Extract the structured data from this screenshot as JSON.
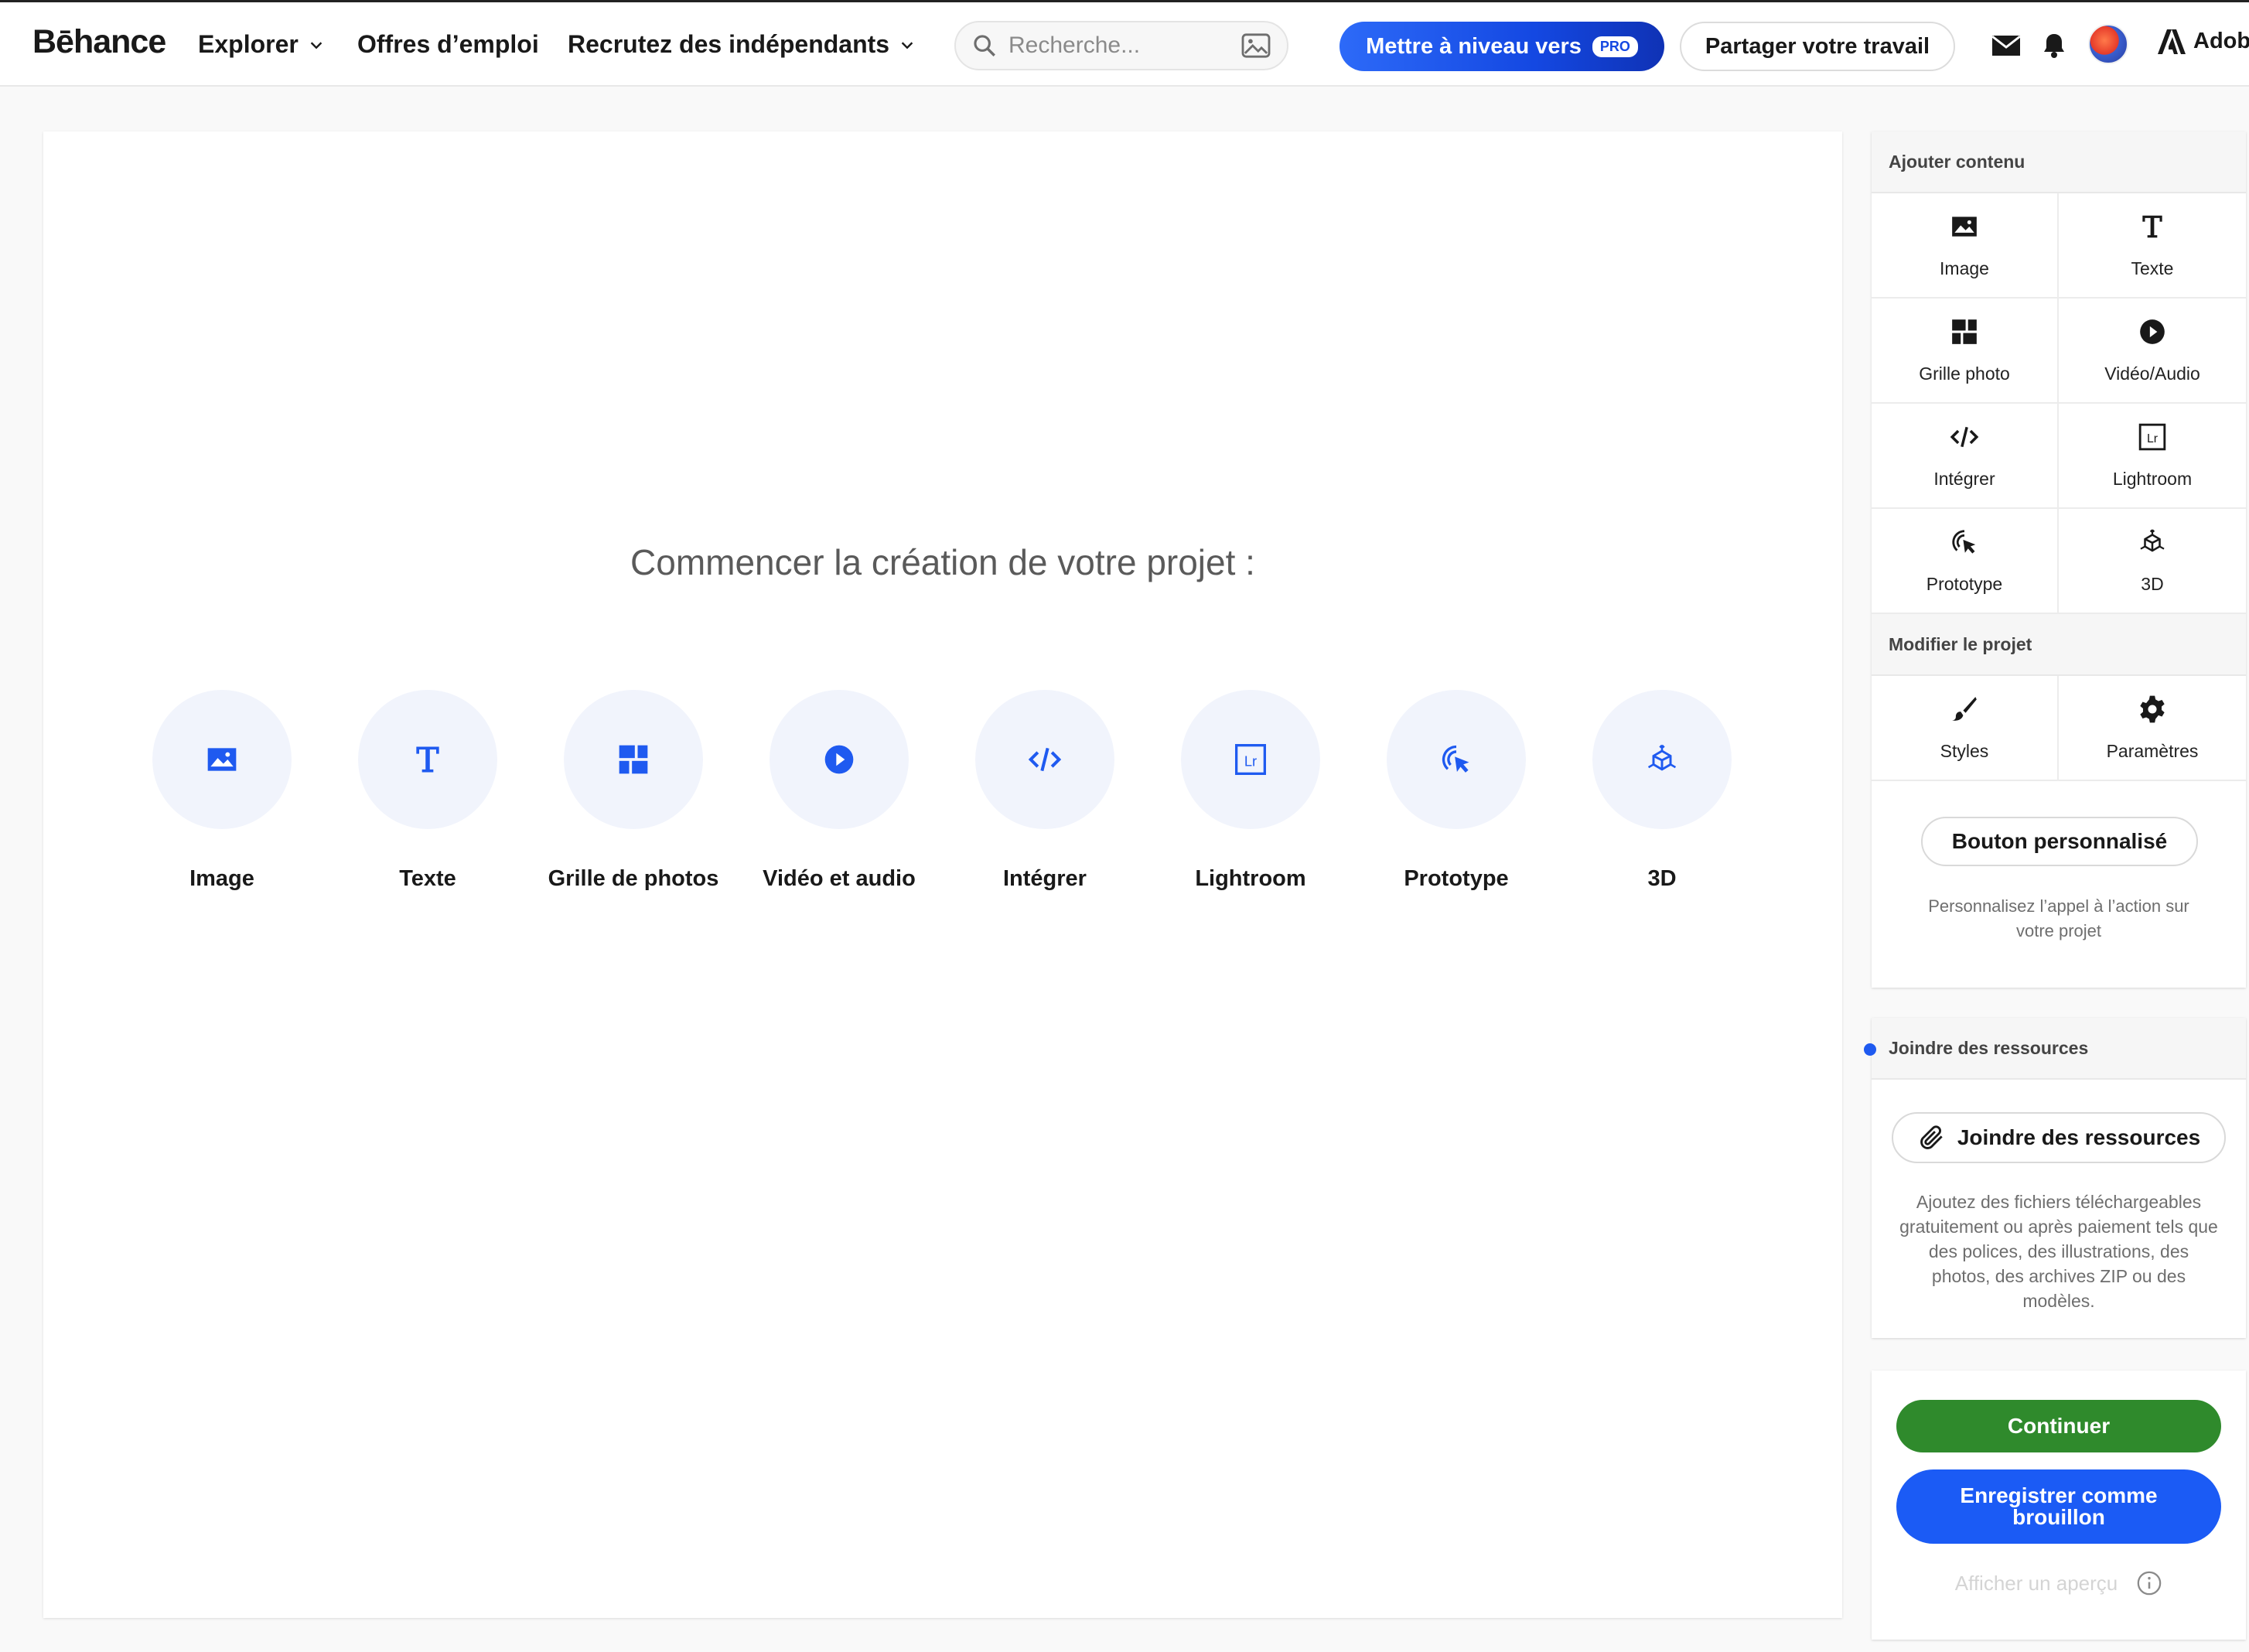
{
  "header": {
    "logo": "Bēhance",
    "nav": [
      {
        "label": "Explorer"
      },
      {
        "label": "Offres d’emploi"
      },
      {
        "label": "Recrutez des indépendants"
      }
    ],
    "search_placeholder": "Recherche...",
    "upgrade_label": "Mettre à niveau vers",
    "pro_badge": "PRO",
    "share_label": "Partager votre travail",
    "adobe_label": "Adobe"
  },
  "canvas": {
    "title": "Commencer la création de votre projet :",
    "tiles": [
      {
        "label": "Image",
        "icon": "image-icon"
      },
      {
        "label": "Texte",
        "icon": "text-icon"
      },
      {
        "label": "Grille de photos",
        "icon": "photo-grid-icon"
      },
      {
        "label": "Vidéo et audio",
        "icon": "play-icon"
      },
      {
        "label": "Intégrer",
        "icon": "embed-code-icon"
      },
      {
        "label": "Lightroom",
        "icon": "lightroom-icon"
      },
      {
        "label": "Prototype",
        "icon": "prototype-cursor-icon"
      },
      {
        "label": "3D",
        "icon": "3d-cube-icon"
      }
    ]
  },
  "sidebar": {
    "add_content": {
      "heading": "Ajouter contenu",
      "items": [
        {
          "label": "Image"
        },
        {
          "label": "Texte"
        },
        {
          "label": "Grille photo"
        },
        {
          "label": "Vidéo/Audio"
        },
        {
          "label": "Intégrer"
        },
        {
          "label": "Lightroom"
        },
        {
          "label": "Prototype"
        },
        {
          "label": "3D"
        }
      ]
    },
    "edit_project": {
      "heading": "Modifier le projet",
      "items": [
        {
          "label": "Styles"
        },
        {
          "label": "Paramètres"
        }
      ],
      "custom_button_label": "Bouton personnalisé",
      "custom_button_hint": "Personnalisez l’appel à l’action sur votre projet"
    },
    "resources": {
      "heading": "Joindre des ressources",
      "button_label": "Joindre des ressources",
      "hint": "Ajoutez des fichiers téléchargeables gratuitement ou après paiement tels que des polices, des illustrations, des photos, des archives ZIP ou des modèles."
    },
    "actions": {
      "continue_label": "Continuer",
      "draft_label": "Enregistrer comme brouillon",
      "preview_label": "Afficher un aperçu"
    }
  },
  "colors": {
    "accent_blue": "#1b5bf5",
    "continue_green": "#2f8a2c",
    "tile_icon_blue": "#1f5af0",
    "tile_bg": "#f1f4fc"
  }
}
